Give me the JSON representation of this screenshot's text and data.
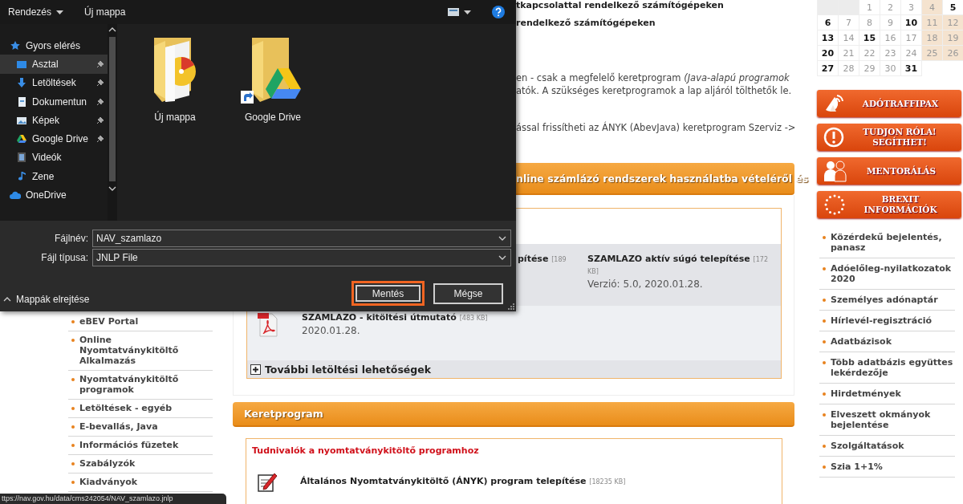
{
  "page": {
    "intro_lines": [
      "tkapcsolattal rendelkező számítógépeken",
      "rendelkező számítógépeken"
    ],
    "paragraph_lines": [
      "en - csak a megfelelő keretprogram *(Java-alapú programok*",
      "atók. A szükséges keretprogramok a lap aljáról tölthetők le."
    ],
    "update_line": "ással frissítheti az ÁNYK (AbevJava) keretprogram Szerviz ->",
    "section_title": "nline számlázó rendszerek használatba vételéről és",
    "downloads": [
      {
        "title": "pítése",
        "size": "[189"
      },
      {
        "title": "SZAMLAZO aktív súgó telepítése",
        "size": "[172 KB]",
        "detail": "Verzió: 5.0, 2020.01.28."
      }
    ],
    "pdf_item": {
      "title": "SZAMLAZO - kitöltési útmutató",
      "size": "[483 KB]",
      "detail": "2020.01.28."
    },
    "more": {
      "label": "További letöltési lehetőségek",
      "expanded": false
    },
    "framework": {
      "title": "Keretprogram",
      "subtitle": "Tudnivalók a nyomtatványkitöltő programhoz",
      "item": {
        "title": "Általános Nyomtatványkitöltő (ÁNYK) program telepítése",
        "size": "[18235 KB]"
      }
    }
  },
  "left_nav": [
    "eBEV Portal",
    "Online Nyomtatványkitöltő Alkalmazás",
    "Nyomtatványkitöltő programok",
    "Letöltések - egyéb",
    "E-bevallás, Java",
    "Információs füzetek",
    "Szabályzók",
    "Kiadványok"
  ],
  "calendar": {
    "weeks": [
      [
        {
          "kind": "blank"
        },
        {
          "kind": "blank"
        },
        {
          "kind": "day",
          "day": "1",
          "bold": false,
          "weekend": false
        },
        {
          "kind": "day",
          "day": "2",
          "bold": false,
          "weekend": false
        },
        {
          "kind": "day",
          "day": "3",
          "bold": false,
          "weekend": false
        },
        {
          "kind": "day",
          "day": "4",
          "bold": false,
          "weekend": true
        },
        {
          "kind": "day",
          "day": "5",
          "bold": true,
          "weekend": false
        }
      ],
      [
        {
          "kind": "day",
          "day": "6",
          "bold": true,
          "weekend": false
        },
        {
          "kind": "day",
          "day": "7",
          "bold": false,
          "weekend": false
        },
        {
          "kind": "day",
          "day": "8",
          "bold": false,
          "weekend": false
        },
        {
          "kind": "day",
          "day": "9",
          "bold": false,
          "weekend": false
        },
        {
          "kind": "day",
          "day": "10",
          "bold": true,
          "weekend": false
        },
        {
          "kind": "day",
          "day": "11",
          "bold": false,
          "weekend": true
        },
        {
          "kind": "day",
          "day": "12",
          "bold": false,
          "weekend": true
        }
      ],
      [
        {
          "kind": "day",
          "day": "13",
          "bold": true,
          "weekend": false
        },
        {
          "kind": "day",
          "day": "14",
          "bold": false,
          "weekend": false
        },
        {
          "kind": "day",
          "day": "15",
          "bold": true,
          "weekend": false
        },
        {
          "kind": "day",
          "day": "16",
          "bold": false,
          "weekend": false
        },
        {
          "kind": "day",
          "day": "17",
          "bold": false,
          "weekend": false
        },
        {
          "kind": "day",
          "day": "18",
          "bold": false,
          "weekend": true
        },
        {
          "kind": "day",
          "day": "19",
          "bold": false,
          "weekend": true
        }
      ],
      [
        {
          "kind": "day",
          "day": "20",
          "bold": true,
          "weekend": false
        },
        {
          "kind": "day",
          "day": "21",
          "bold": false,
          "weekend": false
        },
        {
          "kind": "day",
          "day": "22",
          "bold": false,
          "weekend": false
        },
        {
          "kind": "day",
          "day": "23",
          "bold": false,
          "weekend": false
        },
        {
          "kind": "day",
          "day": "24",
          "bold": false,
          "weekend": false
        },
        {
          "kind": "day",
          "day": "25",
          "bold": false,
          "weekend": true
        },
        {
          "kind": "day",
          "day": "26",
          "bold": false,
          "weekend": true
        }
      ],
      [
        {
          "kind": "day",
          "day": "27",
          "bold": true,
          "weekend": false
        },
        {
          "kind": "day",
          "day": "28",
          "bold": false,
          "weekend": false
        },
        {
          "kind": "day",
          "day": "29",
          "bold": false,
          "weekend": false
        },
        {
          "kind": "day",
          "day": "30",
          "bold": false,
          "weekend": false
        },
        {
          "kind": "day",
          "day": "31",
          "bold": true,
          "weekend": false
        }
      ]
    ]
  },
  "promo_buttons": [
    {
      "kind": "antenna",
      "lines": [
        "ADÓTRAFFIPAX"
      ]
    },
    {
      "kind": "alert",
      "lines": [
        "TUDJON RÓLA!",
        "SEGÍTHET!"
      ]
    },
    {
      "kind": "people",
      "lines": [
        "MENTORÁLÁS"
      ]
    },
    {
      "kind": "stars",
      "lines": [
        "BREXIT",
        "INFORMÁCIÓK"
      ]
    }
  ],
  "right_links": [
    "Közérdekű bejelentés, panasz",
    "Adóelőleg-nyilatkozatok 2020",
    "Személyes adónaptár",
    "Hírlevél-regisztráció",
    "Adatbázisok",
    "Több adatbázis együttes lekérdezője",
    "Hirdetmények",
    "Elveszett okmányok bejelentése",
    "Szolgáltatások",
    "Szia 1+1%"
  ],
  "status_url": "ttps://nav.gov.hu/data/cms242054/NAV_szamlazo.jnlp",
  "dialog": {
    "toolbar": {
      "organize": "Rendezés",
      "new_folder": "Új mappa"
    },
    "nav": [
      {
        "label": "Gyors elérés",
        "selected": false,
        "children": [
          {
            "label": "Asztal",
            "selected": true,
            "pinned": true
          },
          {
            "label": "Letöltések",
            "selected": false,
            "pinned": true
          },
          {
            "label": "Dokumentun",
            "selected": false,
            "pinned": true
          },
          {
            "label": "Képek",
            "selected": false,
            "pinned": true
          },
          {
            "label": "Google Drive",
            "selected": false,
            "pinned": true
          },
          {
            "label": "Videók",
            "selected": false,
            "pinned": false
          },
          {
            "label": "Zene",
            "selected": false,
            "pinned": false
          }
        ]
      },
      {
        "label": "OneDrive",
        "selected": false
      }
    ],
    "files": [
      {
        "name": "Új mappa",
        "shortcut": false
      },
      {
        "name": "Google Drive",
        "shortcut": true
      }
    ],
    "filename": {
      "label": "Fájlnév:",
      "value": "NAV_szamlazo"
    },
    "filetype": {
      "label": "Fájl típusa:",
      "value": "JNLP File"
    },
    "hide_folders": "Mappák elrejtése",
    "buttons": [
      {
        "label": "Mentés",
        "highlighted": true
      },
      {
        "label": "Mégse",
        "highlighted": false
      }
    ]
  }
}
